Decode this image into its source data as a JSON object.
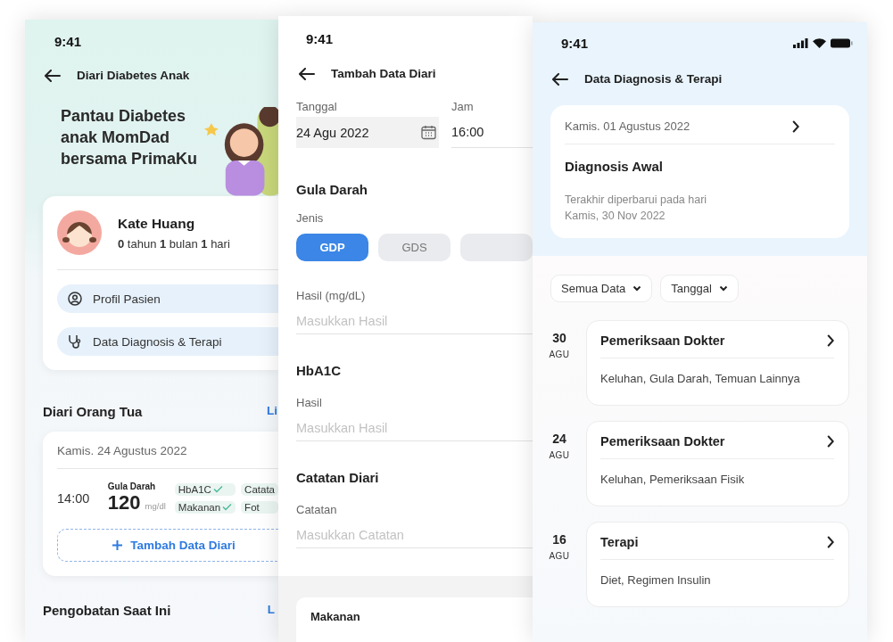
{
  "diary_home": {
    "status_time": "9:41",
    "title": "Diari Diabetes Anak",
    "headline": "Pantau Diabetes anak MomDad bersama PrimaKu",
    "patient": {
      "name": "Kate Huang",
      "age": "**0** tahun **1** bulan **1** hari"
    },
    "menu": [
      {
        "kind": "profile",
        "label": "Profil Pasien"
      },
      {
        "kind": "diagnosis",
        "label": "Data Diagnosis & Terapi"
      }
    ],
    "diary": {
      "title": "Diari Orang Tua",
      "link": "Li",
      "date": "Kamis. 24 Agustus 2022",
      "time": "14:00",
      "metric_label": "Gula Darah",
      "value": "120",
      "unit": "mg/dl",
      "tags": [
        {
          "label": "HbA1C",
          "done": true
        },
        {
          "label": "Catata",
          "done": false
        },
        {
          "label": "Makanan",
          "done": true
        },
        {
          "label": "Fot",
          "done": false
        }
      ],
      "add_button": "Tambah Data Diari"
    },
    "medication": {
      "title": "Pengobatan Saat Ini",
      "link": "L"
    }
  },
  "add_entry": {
    "status_time": "9:41",
    "title": "Tambah Data Diari",
    "date_field": {
      "label": "Tanggal",
      "value": "24 Agu 2022"
    },
    "time_field": {
      "label": "Jam",
      "value": "16:00"
    },
    "sections": [
      {
        "title": "Gula Darah",
        "type_label": "Jenis",
        "options": [
          {
            "label": "GDP",
            "selected": true
          },
          {
            "label": "GDS",
            "selected": false
          }
        ],
        "field": {
          "label": "Hasil (mg/dL)",
          "placeholder": "Masukkan Hasil"
        }
      },
      {
        "title": "HbA1C",
        "field": {
          "label": "Hasil",
          "placeholder": "Masukkan Hasil"
        }
      },
      {
        "title": "Catatan Diari",
        "field": {
          "label": "Catatan",
          "placeholder": "Masukkan Catatan"
        }
      }
    ],
    "next_card_title": "Makanan"
  },
  "diagnosis": {
    "status_time": "9:41",
    "title": "Data Diagnosis & Terapi",
    "summary": {
      "date": "Kamis. 01 Agustus 2022",
      "heading": "Diagnosis Awal",
      "note": [
        "Terakhir diperbarui pada hari",
        "Kamis, 30 Nov 2022"
      ]
    },
    "filters": [
      "Semua Data",
      "Tanggal"
    ],
    "entries": [
      {
        "day": "30",
        "month": "AGU",
        "title": "Pemeriksaan Dokter",
        "detail": "Keluhan, Gula Darah, Temuan Lainnya"
      },
      {
        "day": "24",
        "month": "AGU",
        "title": "Pemeriksaan Dokter",
        "detail": "Keluhan, Pemeriksaan Fisik"
      },
      {
        "day": "16",
        "month": "AGU",
        "title": "Terapi",
        "detail": "Diet, Regimen Insulin"
      }
    ]
  }
}
